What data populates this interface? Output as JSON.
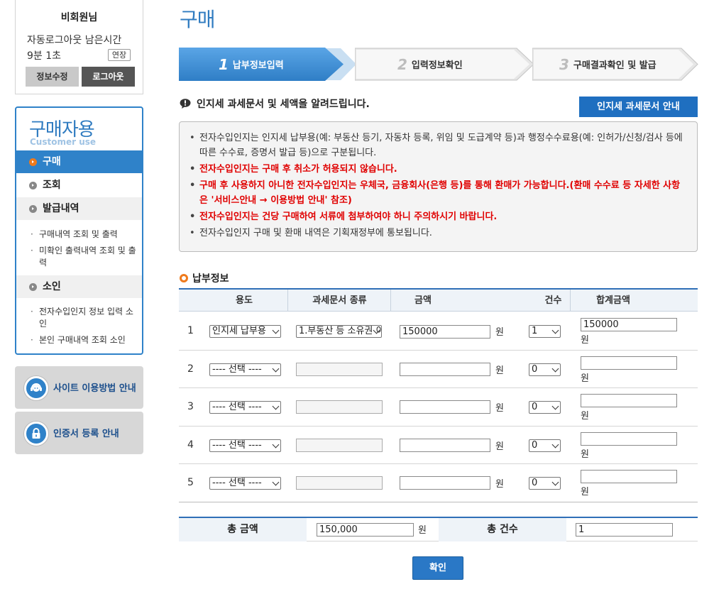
{
  "user": {
    "name": "비회원님",
    "autologout_label": "자동로그아웃 남은시간",
    "remaining": "9분 1초",
    "extend_label": "연장",
    "edit_label": "정보수정",
    "logout_label": "로그아웃"
  },
  "menu": {
    "title": "구매자용",
    "subtitle": "Customer use",
    "items": [
      {
        "label": "구매"
      },
      {
        "label": "조회"
      },
      {
        "label": "발급내역"
      },
      {
        "label": "소인"
      }
    ],
    "issue_subs": [
      "구매내역 조회 및 출력",
      "미확인 출력내역 조회 및 출력"
    ],
    "stamp_subs": [
      "전자수입인지 정보 입력 소인",
      "본인 구매내역 조회 소인"
    ]
  },
  "guides": [
    {
      "label": "사이트 이용방법 안내",
      "icon": "headset-icon"
    },
    {
      "label": "인증서 등록 안내",
      "icon": "lock-icon"
    }
  ],
  "page_title": "구매",
  "steps": [
    {
      "num": "1",
      "label": "납부정보입력",
      "active": true
    },
    {
      "num": "2",
      "label": "입력정보확인",
      "active": false
    },
    {
      "num": "3",
      "label": "구매결과확인 및 발급",
      "active": false
    }
  ],
  "notice": {
    "heading": "인지세 과세문서 및 세액을 알려드립니다.",
    "guide_button": "인지세 과세문서 안내",
    "items": [
      {
        "text": "전자수입인지는 인지세 납부용(예: 부동산 등기, 자동차 등록, 위임 및 도급계약 등)과 행정수수료용(예: 인허가/신청/검사 등에 따른 수수료, 증명서 발급 등)으로 구분됩니다.",
        "red": false
      },
      {
        "text": "전자수입인지는 구매 후 취소가 허용되지 않습니다.",
        "red": true
      },
      {
        "text": "구매 후 사용하지 아니한 전자수입인지는 우체국, 금융회사(은행 등)를 통해 환매가 가능합니다.(환매 수수료 등 자세한 사항은 '서비스안내 → 이용방법 안내' 참조)",
        "red": true
      },
      {
        "text": "전자수입인지는 건당 구매하여 서류에 첨부하여야 하니 주의하시기 바랍니다.",
        "red": true
      },
      {
        "text": "전자수입인지 구매 및 환매 내역은 기획재정부에 통보됩니다.",
        "red": false
      }
    ]
  },
  "payment": {
    "section_title": "납부정보",
    "headers": {
      "purpose": "용도",
      "doc_type": "과세문서 종류",
      "amount": "금액",
      "count": "건수",
      "total": "합계금액"
    },
    "unit": "원",
    "rows": [
      {
        "num": "1",
        "purpose": "인지세 납부용",
        "doc_type": "1.부동산 등 소유권 이전",
        "amount": "150000",
        "count": "1",
        "total": "150000"
      },
      {
        "num": "2",
        "purpose": "---- 선택 ----",
        "doc_type": "",
        "amount": "",
        "count": "0",
        "total": ""
      },
      {
        "num": "3",
        "purpose": "---- 선택 ----",
        "doc_type": "",
        "amount": "",
        "count": "0",
        "total": ""
      },
      {
        "num": "4",
        "purpose": "---- 선택 ----",
        "doc_type": "",
        "amount": "",
        "count": "0",
        "total": ""
      },
      {
        "num": "5",
        "purpose": "---- 선택 ----",
        "doc_type": "",
        "amount": "",
        "count": "0",
        "total": ""
      }
    ]
  },
  "totals": {
    "amount_label": "총 금액",
    "amount_value": "150,000",
    "count_label": "총 건수",
    "count_value": "1"
  },
  "confirm_label": "확인",
  "colors": {
    "primary": "#2f82c9",
    "accent": "#ef7a1c",
    "warning": "#e00000"
  }
}
